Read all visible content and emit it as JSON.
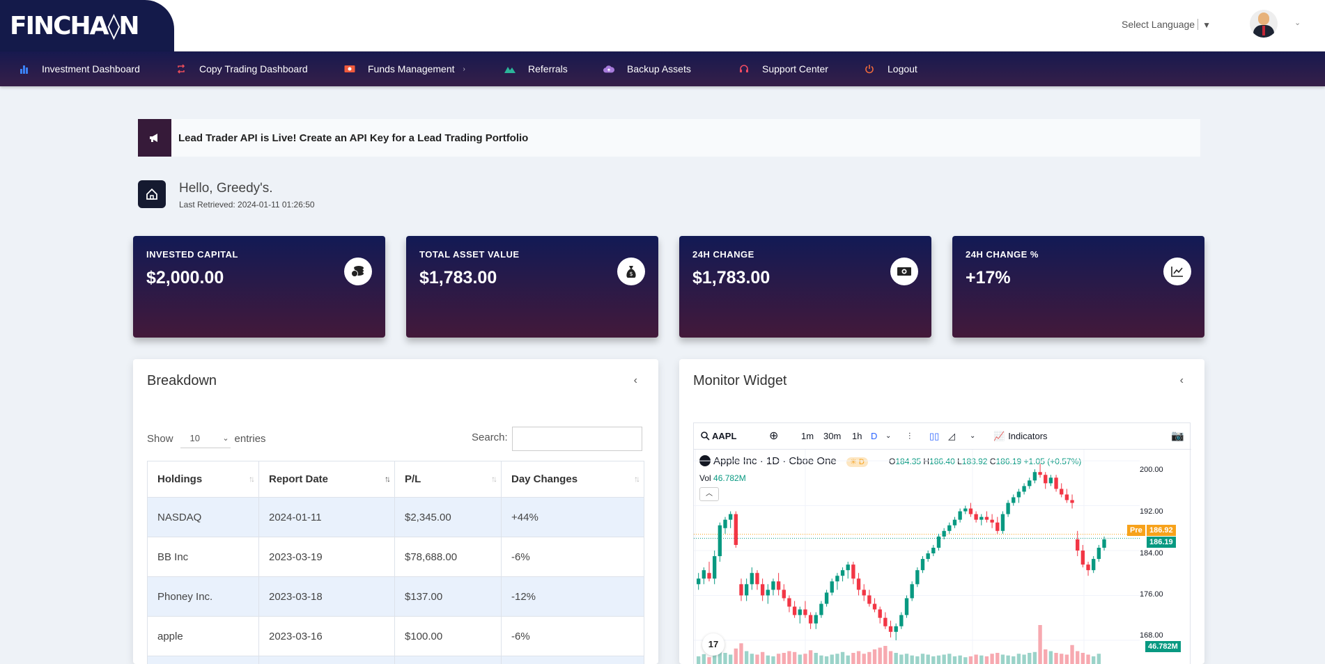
{
  "header": {
    "logo_text": "FINCHA◊N",
    "language": "Select Language",
    "language_arrow": "▼"
  },
  "nav": [
    {
      "label": "Investment Dashboard",
      "icon": "bar-chart-icon",
      "color": "#3b82f6"
    },
    {
      "label": "Copy Trading Dashboard",
      "icon": "repeat-icon",
      "color": "#e74c5a"
    },
    {
      "label": "Funds Management",
      "icon": "money-icon",
      "color": "#f05a3c"
    },
    {
      "label": "Referrals",
      "icon": "mountain-icon",
      "color": "#2bb59a"
    },
    {
      "label": "Backup Assets",
      "icon": "cloud-upload-icon",
      "color": "#a77bdb"
    },
    {
      "label": "Support Center",
      "icon": "headset-icon",
      "color": "#ef4b63"
    },
    {
      "label": "Logout",
      "icon": "power-icon",
      "color": "#f06a3c"
    }
  ],
  "announcement": "Lead Trader API is Live! Create an API Key for a Lead Trading Portfolio",
  "greeting": {
    "hello": "Hello, Greedy's.",
    "retrieved": "Last Retrieved: 2024-01-11 01:26:50"
  },
  "cards": [
    {
      "label": "INVESTED CAPITAL",
      "value": "$2,000.00",
      "icon": "coins-icon"
    },
    {
      "label": "TOTAL ASSET VALUE",
      "value": "$1,783.00",
      "icon": "money-bag-icon"
    },
    {
      "label": "24H CHANGE",
      "value": "$1,783.00",
      "icon": "banknote-icon"
    },
    {
      "label": "24H CHANGE %",
      "value": "+17%",
      "icon": "line-chart-icon"
    }
  ],
  "breakdown": {
    "title": "Breakdown",
    "show_label": "Show",
    "entries_value": "10",
    "entries_label": "entries",
    "search_label": "Search:",
    "columns": [
      "Holdings",
      "Report Date",
      "P/L",
      "Day Changes"
    ],
    "rows": [
      {
        "holding": "NASDAQ",
        "date": "2024-01-11",
        "pl": "$2,345.00",
        "change": "+44%",
        "positive": true
      },
      {
        "holding": "BB Inc",
        "date": "2023-03-19",
        "pl": "$78,688.00",
        "change": "-6%",
        "positive": false
      },
      {
        "holding": "Phoney Inc.",
        "date": "2023-03-18",
        "pl": "$137.00",
        "change": "-12%",
        "positive": false
      },
      {
        "holding": "apple",
        "date": "2023-03-16",
        "pl": "$100.00",
        "change": "-6%",
        "positive": false
      }
    ]
  },
  "monitor": {
    "title": "Monitor Widget",
    "symbol": "AAPL",
    "intervals": [
      "1m",
      "30m",
      "1h",
      "D"
    ],
    "indicators": "Indicators",
    "legend": "Apple Inc · 1D · Cboe One",
    "session_badge": "D",
    "ohlc": {
      "O": "184.35",
      "H": "186.40",
      "L": "183.92",
      "C": "186.19",
      "chg": "+1.05 (+0.57%)"
    },
    "vol_label": "Vol",
    "vol_value": "46.782M",
    "price_axis": [
      "200.00",
      "192.00",
      "184.00",
      "176.00",
      "168.00"
    ],
    "pre_label": "Pre",
    "pre_price": "186.92",
    "last_price": "186.19",
    "logo": "17",
    "up_color": "#089981",
    "down_color": "#f23645",
    "pre_color": "#f7a21b"
  },
  "chart_data": {
    "type": "candlestick",
    "ylim": [
      166,
      202
    ],
    "candles": [
      [
        178,
        180,
        177,
        179
      ],
      [
        179,
        181,
        178,
        180.5
      ],
      [
        180,
        182,
        178.5,
        179
      ],
      [
        179,
        184,
        178,
        183
      ],
      [
        183,
        189,
        182,
        188.5
      ],
      [
        188,
        190,
        187,
        189.5
      ],
      [
        189.5,
        191,
        188,
        190.5
      ],
      [
        190.5,
        191,
        184.5,
        185
      ],
      [
        178,
        179,
        175,
        176
      ],
      [
        176,
        179,
        175,
        178
      ],
      [
        178,
        181,
        177,
        180
      ],
      [
        180,
        180.5,
        177,
        178
      ],
      [
        178,
        179,
        175,
        176
      ],
      [
        176,
        178,
        174.5,
        177
      ],
      [
        177,
        179,
        176,
        178.5
      ],
      [
        178.5,
        180,
        176,
        177
      ],
      [
        177,
        178,
        175,
        175.5
      ],
      [
        175.5,
        176,
        173,
        174
      ],
      [
        174,
        175,
        172,
        172.5
      ],
      [
        172.5,
        174,
        171,
        173.5
      ],
      [
        173.5,
        175,
        172,
        172.5
      ],
      [
        172.5,
        173,
        170,
        171
      ],
      [
        171,
        173,
        170,
        172.5
      ],
      [
        172.5,
        175,
        172,
        174.5
      ],
      [
        174.5,
        177,
        174,
        176.5
      ],
      [
        176.5,
        179,
        176,
        178.5
      ],
      [
        178.5,
        180,
        177,
        179.5
      ],
      [
        179.5,
        181,
        178.5,
        180.5
      ],
      [
        180.5,
        182,
        179,
        181.5
      ],
      [
        181.5,
        182,
        178,
        179
      ],
      [
        179,
        180,
        176,
        177
      ],
      [
        177,
        178,
        175,
        176
      ],
      [
        176,
        177,
        174,
        174.5
      ],
      [
        174.5,
        175.5,
        173,
        173.5
      ],
      [
        173.5,
        174,
        171,
        172
      ],
      [
        172,
        173,
        170,
        170.5
      ],
      [
        170.5,
        171.5,
        168.5,
        169.5
      ],
      [
        169.5,
        171,
        168,
        170.5
      ],
      [
        170.5,
        173,
        170,
        172.5
      ],
      [
        172.5,
        176,
        172,
        175.5
      ],
      [
        175.5,
        178.5,
        175,
        178
      ],
      [
        178,
        181,
        177.5,
        180.5
      ],
      [
        180.5,
        183,
        180,
        182.5
      ],
      [
        182.5,
        184,
        182,
        183.5
      ],
      [
        183.5,
        185,
        183,
        184.5
      ],
      [
        184.5,
        187,
        184,
        186.5
      ],
      [
        186.5,
        188,
        186,
        187.5
      ],
      [
        187.5,
        189,
        187,
        188.5
      ],
      [
        188.5,
        190,
        188,
        189.5
      ],
      [
        189.5,
        191.5,
        189,
        191
      ],
      [
        191,
        192,
        190.5,
        191.5
      ],
      [
        191.5,
        192.5,
        190,
        190.5
      ],
      [
        190.5,
        191,
        189,
        189.5
      ],
      [
        189.5,
        190.5,
        188.5,
        190
      ],
      [
        190,
        191,
        189,
        189.5
      ],
      [
        189.5,
        190.5,
        188,
        189
      ],
      [
        189,
        190,
        187,
        187.5
      ],
      [
        187.5,
        191,
        187,
        190.5
      ],
      [
        190.5,
        193,
        190,
        192.5
      ],
      [
        192.5,
        194,
        192,
        193.5
      ],
      [
        193.5,
        195,
        192.5,
        194.5
      ],
      [
        194.5,
        196,
        194,
        195.5
      ],
      [
        195.5,
        197,
        195,
        196.5
      ],
      [
        196.5,
        198.5,
        196,
        198
      ],
      [
        198,
        199.5,
        197,
        197.5
      ],
      [
        197.5,
        198,
        195,
        196
      ],
      [
        196,
        197.5,
        195.5,
        197
      ],
      [
        197,
        197.5,
        194.5,
        195
      ],
      [
        195,
        196,
        193.5,
        194
      ],
      [
        194,
        195,
        192.5,
        193
      ],
      [
        193,
        194,
        191.5,
        192.5
      ],
      [
        186,
        187.5,
        183,
        184
      ],
      [
        184,
        185,
        181,
        181.5
      ],
      [
        181.5,
        182,
        179.5,
        180.5
      ],
      [
        180.5,
        183,
        180,
        182.5
      ],
      [
        182.5,
        185,
        182,
        184.5
      ],
      [
        184.5,
        186.5,
        184,
        186
      ]
    ],
    "volumes": [
      40,
      45,
      38,
      50,
      62,
      48,
      44,
      58,
      70,
      52,
      46,
      44,
      50,
      42,
      40,
      46,
      48,
      52,
      50,
      44,
      46,
      54,
      48,
      42,
      40,
      44,
      46,
      50,
      42,
      48,
      52,
      46,
      50,
      56,
      60,
      64,
      52,
      48,
      44,
      46,
      42,
      40,
      46,
      44,
      40,
      42,
      44,
      46,
      40,
      42,
      38,
      40,
      44,
      42,
      40,
      46,
      48,
      44,
      42,
      40,
      46,
      44,
      48,
      50,
      112,
      56,
      52,
      48,
      46,
      44,
      66,
      52,
      48,
      44,
      40,
      46
    ]
  }
}
